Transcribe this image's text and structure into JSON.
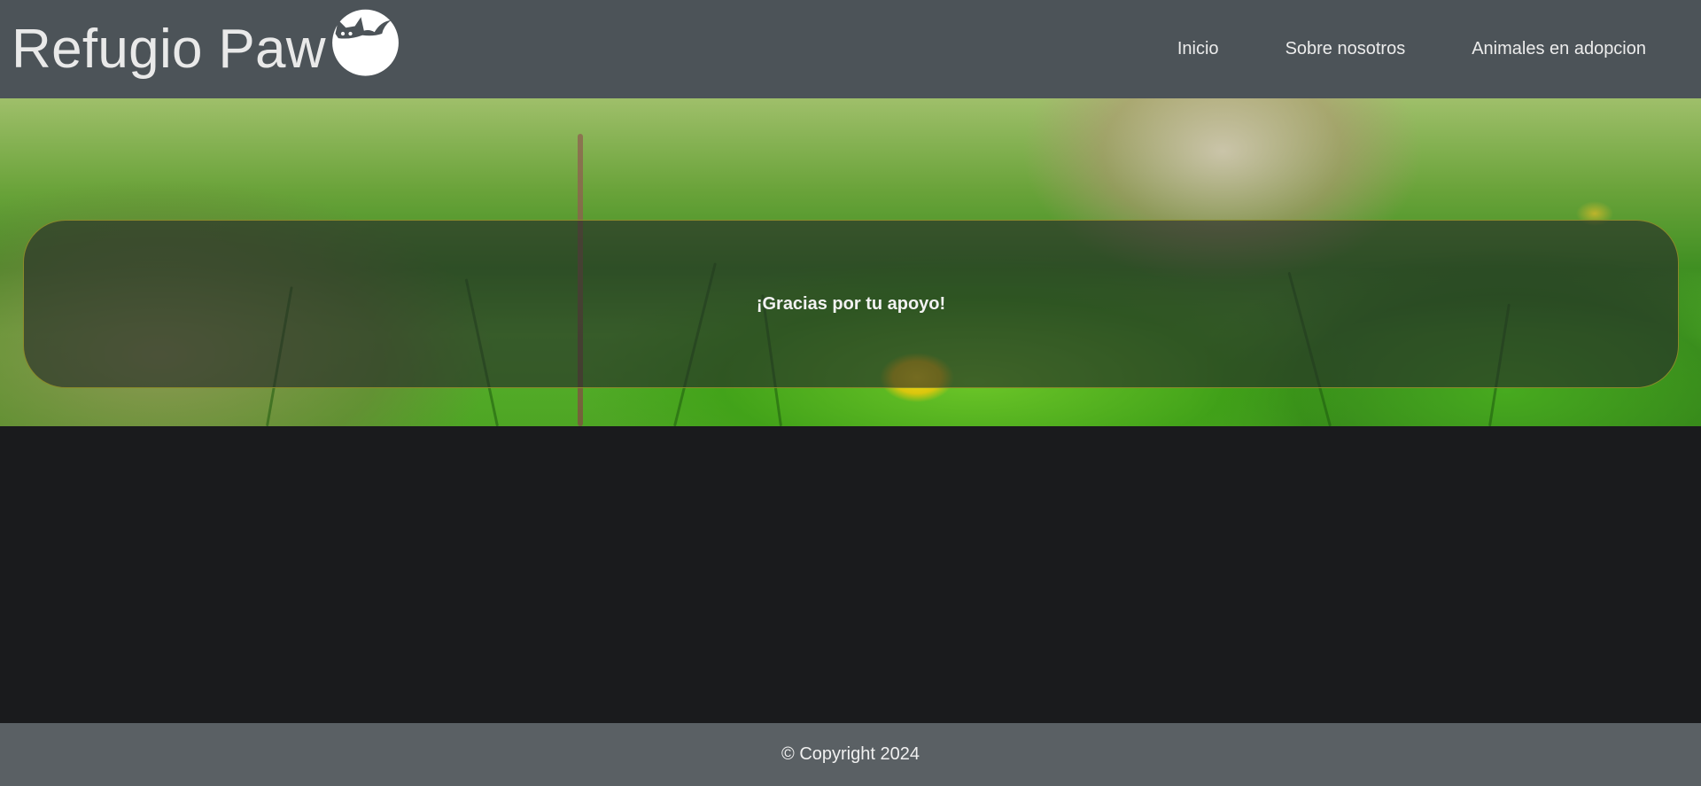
{
  "header": {
    "brand_title": "Refugio Paw",
    "logo_icon": "cat-logo-icon",
    "nav": [
      {
        "label": "Inicio"
      },
      {
        "label": "Sobre nosotros"
      },
      {
        "label": "Animales en adopcion"
      }
    ]
  },
  "hero": {
    "message": "¡Gracias por tu apoyo!",
    "background": "kitten-in-grass-photo"
  },
  "footer": {
    "copyright": "© Copyright 2024"
  },
  "colors": {
    "header_bg": "#4c5358",
    "page_bg": "#1a1b1d",
    "footer_bg": "#5a6064",
    "notice_border": "#8a8a2a"
  }
}
